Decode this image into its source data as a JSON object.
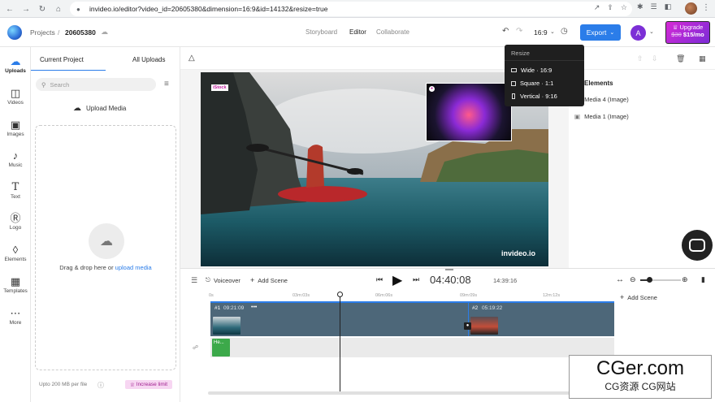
{
  "browser": {
    "url": "invideo.io/editor?video_id=20605380&dimension=16:9&id=14132&resize=true",
    "nav_icons": [
      "back-icon",
      "forward-icon",
      "reload-icon",
      "home-icon"
    ]
  },
  "header": {
    "breadcrumb_projects": "Projects",
    "breadcrumb_sep": "/",
    "project_id": "20605380",
    "tabs": [
      "Storyboard",
      "Editor",
      "Collaborate"
    ],
    "active_tab": "Editor",
    "ratio": "16:9",
    "export_label": "Export",
    "avatar_initial": "A",
    "upgrade_label": "Upgrade",
    "upgrade_old_price": "$30",
    "upgrade_price": "$15/mo"
  },
  "rail": {
    "items": [
      {
        "label": "Uploads",
        "icon": "cloud-upload-icon"
      },
      {
        "label": "Videos",
        "icon": "video-icon"
      },
      {
        "label": "Images",
        "icon": "image-icon"
      },
      {
        "label": "Music",
        "icon": "music-note-icon"
      },
      {
        "label": "Text",
        "icon": "text-icon"
      },
      {
        "label": "Logo",
        "icon": "logo-icon"
      },
      {
        "label": "Elements",
        "icon": "elements-icon"
      },
      {
        "label": "Templates",
        "icon": "templates-icon"
      },
      {
        "label": "More",
        "icon": "more-icon"
      }
    ]
  },
  "uploads": {
    "tab_current": "Current Project",
    "tab_all": "All Uploads",
    "search_placeholder": "Search",
    "upload_button": "Upload Media",
    "drop_text": "Drag & drop here or",
    "drop_link": "upload media",
    "footer_limit": "Upto 200 MB per file",
    "increase_limit": "Increase limit"
  },
  "canvas": {
    "istock_badge": "iStock",
    "watermark": "invideo.io"
  },
  "elements_panel": {
    "title": "Elements",
    "items": [
      "Media 4 (Image)",
      "Media 1 (Image)"
    ]
  },
  "resize_menu": {
    "title": "Resize",
    "options": [
      {
        "label": "Wide · 16:9",
        "icon": "wide-rect-icon"
      },
      {
        "label": "Square · 1:1",
        "icon": "square-icon"
      },
      {
        "label": "Vertical · 9:16",
        "icon": "vertical-rect-icon"
      }
    ]
  },
  "timeline": {
    "voiceover": "Voiceover",
    "add_scene": "Add Scene",
    "current_time": "04:40:08",
    "total_time": "14:39:16",
    "ruler": [
      "0s",
      "03m:03s",
      "06m:06s",
      "09m:09s",
      "12m:12s"
    ],
    "scene1_index": "#1",
    "scene1_duration": "09:21:09",
    "scene1_menu": "•••",
    "scene2_index": "#2",
    "scene2_duration": "05:19:22",
    "audio_clip_label": "He...",
    "add_scene_right": "Add Scene"
  },
  "watermark_overlay": {
    "line1": "CGer.com",
    "line2": "CG资源 CG网站"
  }
}
